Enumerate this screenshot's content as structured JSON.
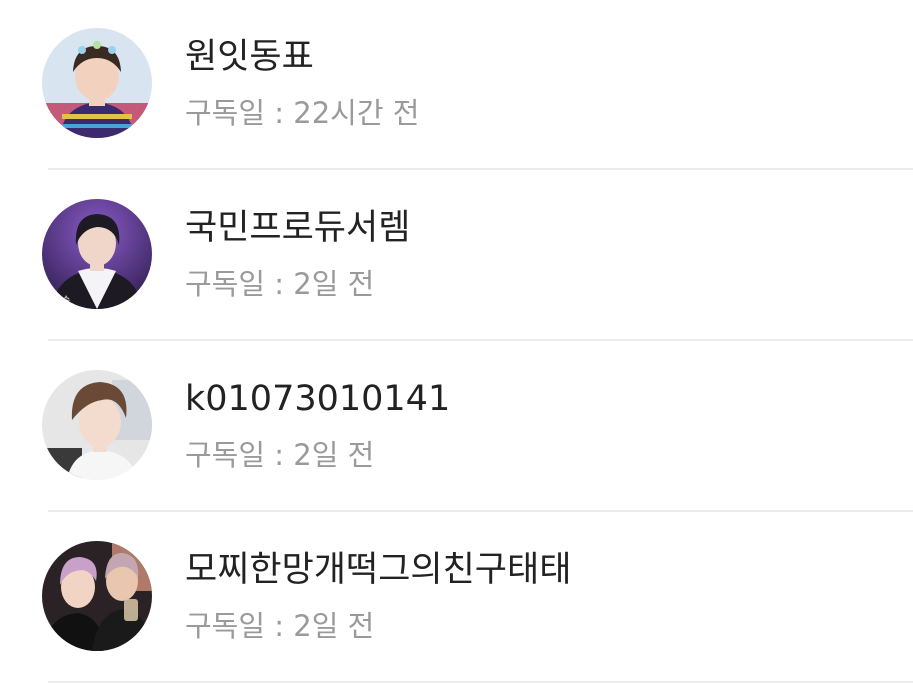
{
  "subscribers": [
    {
      "name": "원잇동표",
      "subscribed_prefix": "구독일 : ",
      "subscribed_value": "22시간 전",
      "avatar_icon": "person-photo-icon"
    },
    {
      "name": "국민프로듀서렘",
      "subscribed_prefix": "구독일 : ",
      "subscribed_value": "2일 전",
      "avatar_icon": "person-photo-icon"
    },
    {
      "name": "k01073010141",
      "subscribed_prefix": "구독일 : ",
      "subscribed_value": "2일 전",
      "avatar_icon": "person-photo-icon"
    },
    {
      "name": "모찌한망개떡그의친구태태",
      "subscribed_prefix": "구독일 : ",
      "subscribed_value": "2일 전",
      "avatar_icon": "person-photo-icon"
    }
  ],
  "colors": {
    "name_text": "#222222",
    "meta_text": "#9a9a9a",
    "divider": "#ececec"
  }
}
